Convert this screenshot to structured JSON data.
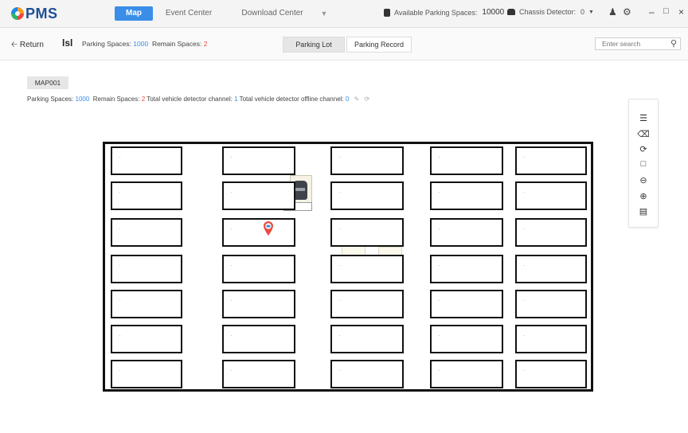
{
  "app": {
    "logo_text": "PMS",
    "nav": [
      {
        "label": "Map",
        "active": true
      },
      {
        "label": "Event Center",
        "active": false
      },
      {
        "label": "Download Center",
        "active": false
      }
    ],
    "available_spaces_label": "Available Parking Spaces:",
    "available_spaces_value": "10000",
    "chassis_label": "Chassis Detector:",
    "chassis_value": "0"
  },
  "subheader": {
    "back_label": "Return",
    "lot_name": "lsl",
    "spaces_label": "Parking Spaces:",
    "spaces_value": "1000",
    "remain_label": "Remain Spaces:",
    "remain_value": "2",
    "tabs": [
      {
        "label": "Parking Lot",
        "active": true
      },
      {
        "label": "Parking Record",
        "active": false
      }
    ],
    "search_placeholder": "Enter search"
  },
  "map": {
    "tab_label": "MAP001",
    "stats": {
      "spaces_label": "Parking Spaces:",
      "spaces_value": "1000",
      "remain_label": "Remain Spaces:",
      "remain_value": "2",
      "detector_label": "Total vehicle detector channel:",
      "detector_value": "1",
      "offline_label": "Total vehicle detector offline channel:",
      "offline_value": "0"
    },
    "toolbox": [
      "layers-icon",
      "clear-icon",
      "reset-icon",
      "select-area-icon",
      "zoom-out-icon",
      "zoom-in-icon",
      "legend-icon"
    ]
  },
  "colors": {
    "accent": "#3b8ee8",
    "alert": "#e84c3d",
    "logo": "#1f4f96"
  }
}
